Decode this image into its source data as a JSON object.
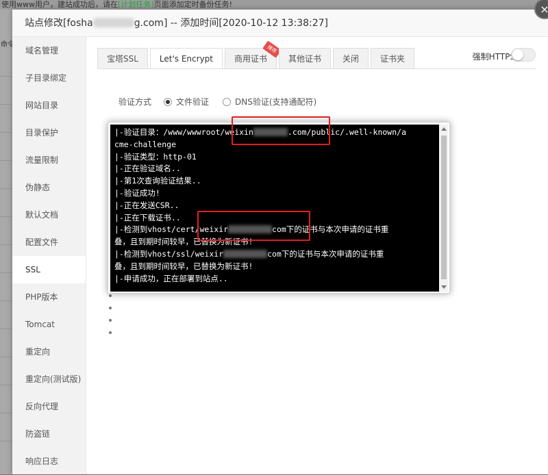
{
  "backdrop": {
    "top_text_prefix": "使用www用户，建站成功后，请在",
    "top_text_link": "[计划任务]",
    "top_text_suffix": "页面添加定时备份任务!",
    "left_text": "命令"
  },
  "modal": {
    "title_prefix": "站点修改[fosha",
    "title_suffix": "g.com] -- 添加时间[2020-10-12 13:38:27]",
    "close_glyph": "×"
  },
  "sidebar": {
    "items": [
      {
        "label": "域名管理"
      },
      {
        "label": "子目录绑定"
      },
      {
        "label": "网站目录"
      },
      {
        "label": "目录保护"
      },
      {
        "label": "流量限制"
      },
      {
        "label": "伪静态"
      },
      {
        "label": "默认文档"
      },
      {
        "label": "配置文件"
      },
      {
        "label": "SSL"
      },
      {
        "label": "PHP版本"
      },
      {
        "label": "Tomcat"
      },
      {
        "label": "重定向"
      },
      {
        "label": "重定向(测试版)"
      },
      {
        "label": "反向代理"
      },
      {
        "label": "防盗链"
      },
      {
        "label": "响应日志"
      }
    ],
    "active": "SSL"
  },
  "tabs": [
    {
      "label": "宝塔SSL"
    },
    {
      "label": "Let's Encrypt"
    },
    {
      "label": "商用证书",
      "badge": "推荐"
    },
    {
      "label": "其他证书"
    },
    {
      "label": "关闭"
    },
    {
      "label": "证书夹"
    }
  ],
  "force_https": {
    "label": "强制HTTPS",
    "enabled": false
  },
  "verify": {
    "label": "验证方式",
    "options": [
      {
        "label": "文件验证",
        "checked": true
      },
      {
        "label": "DNS验证(支持通配符)",
        "checked": false
      }
    ]
  },
  "terminal": {
    "lines": [
      {
        "pre": "|-验证目录：/www/wwwroot/weixin",
        "post": ".com/public/.well-known/a",
        "blur": true
      },
      {
        "pre": "cme-challenge"
      },
      {
        "pre": "|-验证类型：http-01"
      },
      {
        "pre": "|-正在验证域名.."
      },
      {
        "pre": "|-第1次查询验证结果.."
      },
      {
        "pre": "|-验证成功!"
      },
      {
        "pre": "|-正在发送CSR.."
      },
      {
        "pre": "|-正在下载证书.."
      },
      {
        "pre": "|-检测到vhost/cert/weixir",
        "post": "com下的证书与本次申请的证书重",
        "blur": true
      },
      {
        "pre": "叠，且到期时间较早，已替换为新证书!"
      },
      {
        "pre": "|-检测到vhost/ssl/weixir",
        "post": "com下的证书与本次申请的证书重",
        "blur": true
      },
      {
        "pre": "叠，且到期时间较早，已替换为新证书!"
      },
      {
        "pre": "|-申请成功，正在部署到站点.."
      }
    ]
  }
}
